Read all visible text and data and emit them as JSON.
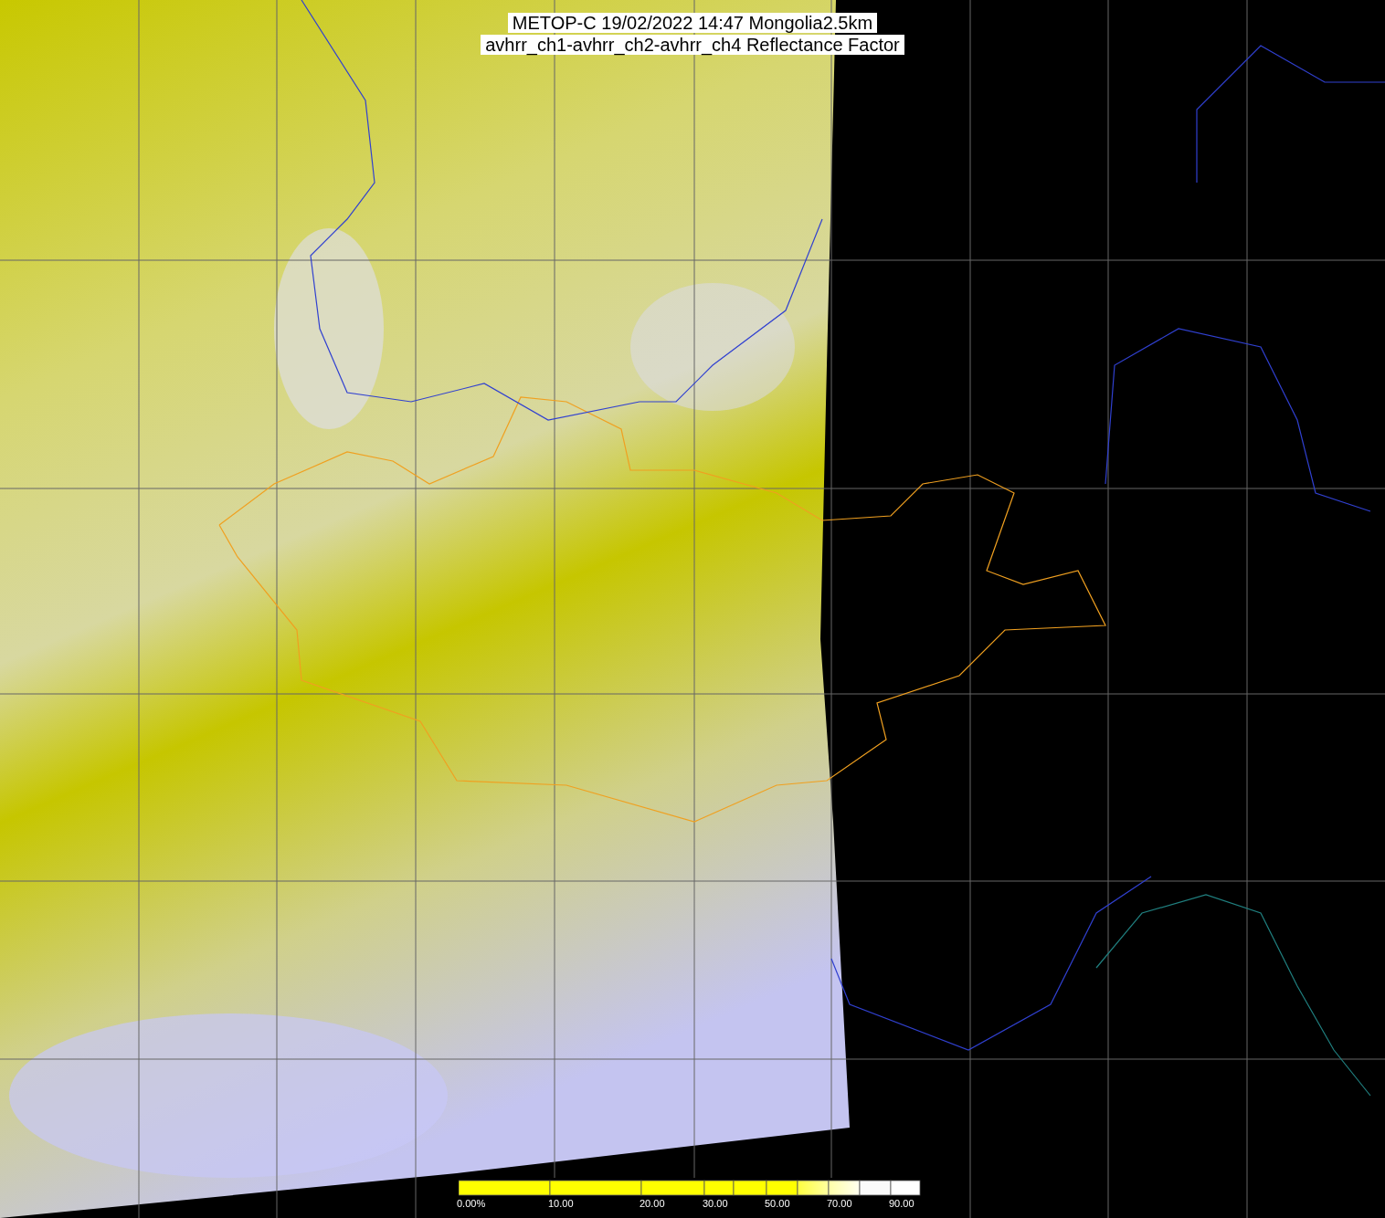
{
  "title": {
    "lines": [
      "METOP-C 19/02/2022 14:47 Mongolia2.5km",
      "avhrr_ch1-avhrr_ch2-avhrr_ch4 Reflectance Factor"
    ]
  },
  "color_bar": {
    "labels": [
      "0.00%",
      "10.00",
      "20.00",
      "30.00",
      "50.00",
      "70.00",
      "90.00"
    ]
  }
}
